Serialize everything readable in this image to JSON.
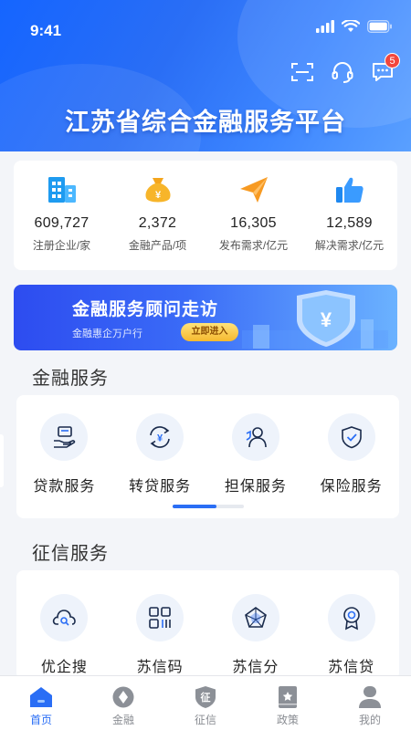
{
  "status_bar": {
    "time": "9:41"
  },
  "header": {
    "title": "江苏省综合金融服务平台",
    "message_badge": "5"
  },
  "stats": [
    {
      "value": "609,727",
      "label": "注册企业/家",
      "icon": "building-icon"
    },
    {
      "value": "2,372",
      "label": "金融产品/项",
      "icon": "money-bag-icon"
    },
    {
      "value": "16,305",
      "label": "发布需求/亿元",
      "icon": "paper-plane-icon"
    },
    {
      "value": "12,589",
      "label": "解决需求/亿元",
      "icon": "thumbs-up-icon"
    }
  ],
  "banner": {
    "title": "金融服务顾问走访",
    "subtitle": "金融惠企万户行",
    "button": "立即进入"
  },
  "finance_services": {
    "title": "金融服务",
    "items": [
      {
        "label": "贷款服务",
        "icon": "loan-icon"
      },
      {
        "label": "转贷服务",
        "icon": "refinance-icon"
      },
      {
        "label": "担保服务",
        "icon": "guarantee-icon"
      },
      {
        "label": "保险服务",
        "icon": "insurance-shield-icon"
      }
    ]
  },
  "credit_services": {
    "title": "征信服务",
    "items": [
      {
        "label": "优企搜",
        "icon": "cloud-search-icon"
      },
      {
        "label": "苏信码",
        "icon": "qr-code-icon"
      },
      {
        "label": "苏信分",
        "icon": "radar-score-icon"
      },
      {
        "label": "苏信贷",
        "icon": "medal-icon"
      }
    ]
  },
  "tabs": [
    {
      "label": "首页",
      "icon": "home-icon",
      "active": true
    },
    {
      "label": "金融",
      "icon": "finance-icon",
      "active": false
    },
    {
      "label": "征信",
      "icon": "credit-icon",
      "active": false
    },
    {
      "label": "政策",
      "icon": "policy-icon",
      "active": false
    },
    {
      "label": "我的",
      "icon": "profile-icon",
      "active": false
    }
  ],
  "colors": {
    "primary": "#2a6ef5",
    "badge": "#f2463d",
    "background": "#f3f5f9"
  }
}
